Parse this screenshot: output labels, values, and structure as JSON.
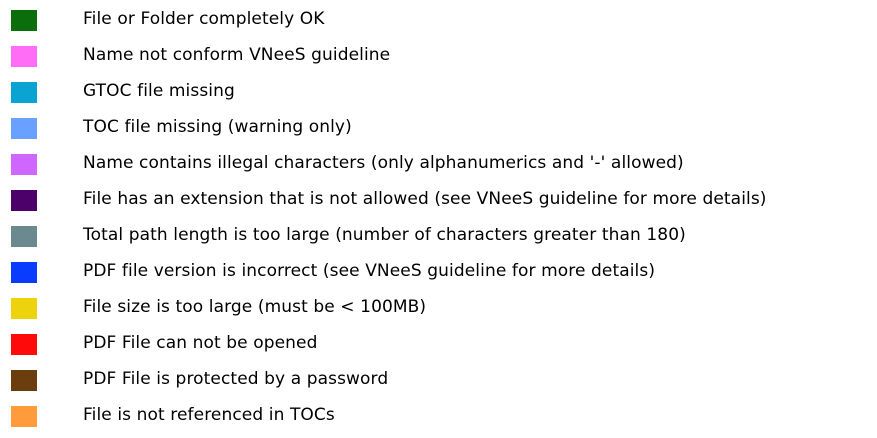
{
  "legend": {
    "items": [
      {
        "label": "File or Folder completely OK",
        "color": "#0a6e0a"
      },
      {
        "label": "Name not conform VNeeS guideline",
        "color": "#ff6cf5"
      },
      {
        "label": "GTOC file missing",
        "color": "#0aa3d2"
      },
      {
        "label": "TOC file missing (warning only)",
        "color": "#6aa0ff"
      },
      {
        "label": "Name contains illegal characters (only alphanumerics and '-' allowed)",
        "color": "#cf66ff"
      },
      {
        "label": "File has an extension that is not allowed (see VNeeS guideline for more details)",
        "color": "#4b006a"
      },
      {
        "label": "Total path length is too large (number of characters greater than 180)",
        "color": "#6b8a90"
      },
      {
        "label": "PDF file version is incorrect (see VNeeS guideline for more details)",
        "color": "#0a3cff"
      },
      {
        "label": "File size is too large (must be < 100MB)",
        "color": "#edd30b"
      },
      {
        "label": "PDF File can not be opened",
        "color": "#ff0a0a"
      },
      {
        "label": "PDF File is protected by a password",
        "color": "#6a3f0d"
      },
      {
        "label": "File is not referenced in TOCs",
        "color": "#ff9b3a"
      }
    ]
  }
}
